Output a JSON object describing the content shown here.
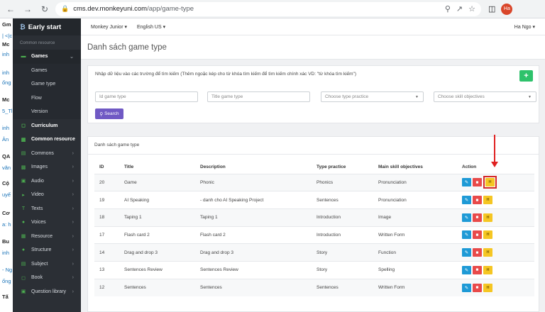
{
  "browser": {
    "url_host": "cms.dev.monkeyuni.com",
    "url_path": "/app/game-type",
    "profile_initials": "Ha"
  },
  "bg_strip": {
    "lines": [
      "Gm",
      "| <|c",
      "Mc",
      "inh",
      "inh",
      "ống",
      "Mc",
      "5_Tl",
      "inh",
      "Ản",
      "QA",
      "văn",
      "Cộ",
      "uyế",
      "Cơ",
      "a: h",
      "Bu",
      "inh",
      "- Ng",
      "ống",
      "Tấ"
    ]
  },
  "sidebar": {
    "brand": "Early start",
    "section_title": "Common resource",
    "games_label": "Games",
    "sub_items": [
      "Games",
      "Game type",
      "Flow",
      "Version"
    ],
    "items": [
      {
        "label": "Curriculum",
        "icon": "book-icon"
      },
      {
        "label": "Common resource",
        "icon": "folder-icon"
      },
      {
        "label": "Commons",
        "icon": "file-icon"
      },
      {
        "label": "Images",
        "icon": "image-icon"
      },
      {
        "label": "Audio",
        "icon": "audio-icon"
      },
      {
        "label": "Video",
        "icon": "video-icon"
      },
      {
        "label": "Texts",
        "icon": "text-icon"
      },
      {
        "label": "Voices",
        "icon": "voice-icon"
      },
      {
        "label": "Resource",
        "icon": "resource-icon"
      },
      {
        "label": "Structure",
        "icon": "structure-icon"
      },
      {
        "label": "Subject",
        "icon": "subject-icon"
      },
      {
        "label": "Book",
        "icon": "book-icon"
      },
      {
        "label": "Question library",
        "icon": "question-icon"
      }
    ]
  },
  "topbar": {
    "product": "Monkey Junior",
    "language": "English US",
    "user": "Ha Ngo"
  },
  "page": {
    "title": "Danh sách game type"
  },
  "filter": {
    "hint": "Nhập dữ liệu vào các trường để tìm kiếm (Thêm ngoặc kép cho từ khóa tìm kiếm để tìm kiếm chính xác VD: \"từ khóa tìm kiếm\")",
    "add_label": "+",
    "id_placeholder": "Id game type",
    "title_placeholder": "Title game type",
    "type_practice": "Choose type practice",
    "skill_objectives": "Choose skill objectives",
    "search_label": "Search"
  },
  "list": {
    "title": "Danh sách game type",
    "columns": [
      "ID",
      "Title",
      "Description",
      "Type practice",
      "Main skill objectives",
      "Action"
    ],
    "rows": [
      {
        "id": "20",
        "title": "Game",
        "description": "Phonic",
        "type": "Phonics",
        "skill": "Pronunciation"
      },
      {
        "id": "19",
        "title": "AI Speaking",
        "description": "- danh cho AI Speaking Project",
        "type": "Sentences",
        "skill": "Pronunciation"
      },
      {
        "id": "18",
        "title": "Taping 1",
        "description": "Taping 1",
        "type": "Introduction",
        "skill": "Image"
      },
      {
        "id": "17",
        "title": "Flash card 2",
        "description": "Flash card 2",
        "type": "Introduction",
        "skill": "Written Form"
      },
      {
        "id": "14",
        "title": "Drag and drop 3",
        "description": "Drag and drop 3",
        "type": "Story",
        "skill": "Function"
      },
      {
        "id": "13",
        "title": "Sentences Review",
        "description": "Sentences Review",
        "type": "Story",
        "skill": "Spelling"
      },
      {
        "id": "12",
        "title": "Sentences",
        "description": "Sentences",
        "type": "Sentences",
        "skill": "Written Form"
      }
    ],
    "action_edit_icon": "pencil-icon",
    "action_delete_icon": "trash-icon",
    "action_history_icon": "history-icon",
    "history_glyph": "H"
  },
  "colors": {
    "sidebar_bg": "#2b2f35",
    "accent_green": "#2ec26b",
    "search_purple": "#7059c4",
    "edit_blue": "#1e9ad6",
    "delete_red": "#e84a4a",
    "history_yellow": "#f5c623",
    "annotation_red": "#d42a2a"
  }
}
